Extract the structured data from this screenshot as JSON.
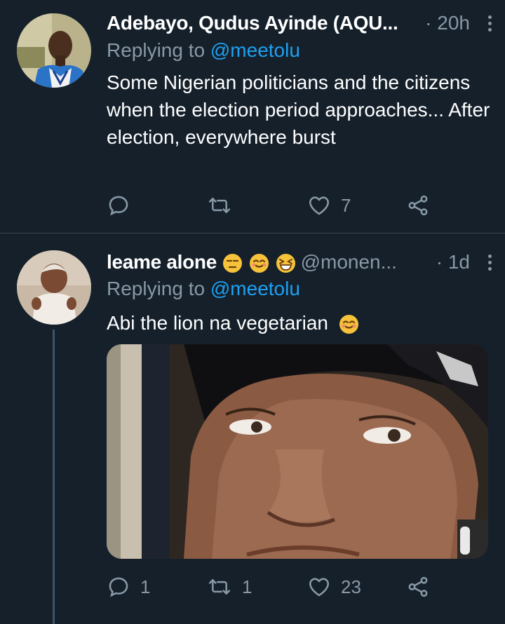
{
  "tweets": [
    {
      "name": "Adebayo, Qudus Ayinde (AQU...",
      "handle": "",
      "time": "· 20h",
      "replying_prefix": "Replying to ",
      "replying_to": "@meetolu",
      "text": "Some Nigerian politicians and the citizens when the election period approaches... After election, everywhere burst",
      "actions": {
        "reply": "",
        "retweet": "",
        "like": "7",
        "share": ""
      }
    },
    {
      "name": "leame alone",
      "handle": "@monen...",
      "time": "· 1d",
      "replying_prefix": "Replying to ",
      "replying_to": "@meetolu",
      "text": "Abi the lion na vegetarian",
      "actions": {
        "reply": "1",
        "retweet": "1",
        "like": "23",
        "share": ""
      }
    }
  ],
  "icons": {
    "reply": "reply-icon",
    "retweet": "retweet-icon",
    "like": "heart-icon",
    "share": "share-icon",
    "more": "more-vertical-icon"
  },
  "colors": {
    "background": "#15202b",
    "secondary_text": "#8899a6",
    "link": "#1da1f2",
    "divider": "#38444d"
  }
}
